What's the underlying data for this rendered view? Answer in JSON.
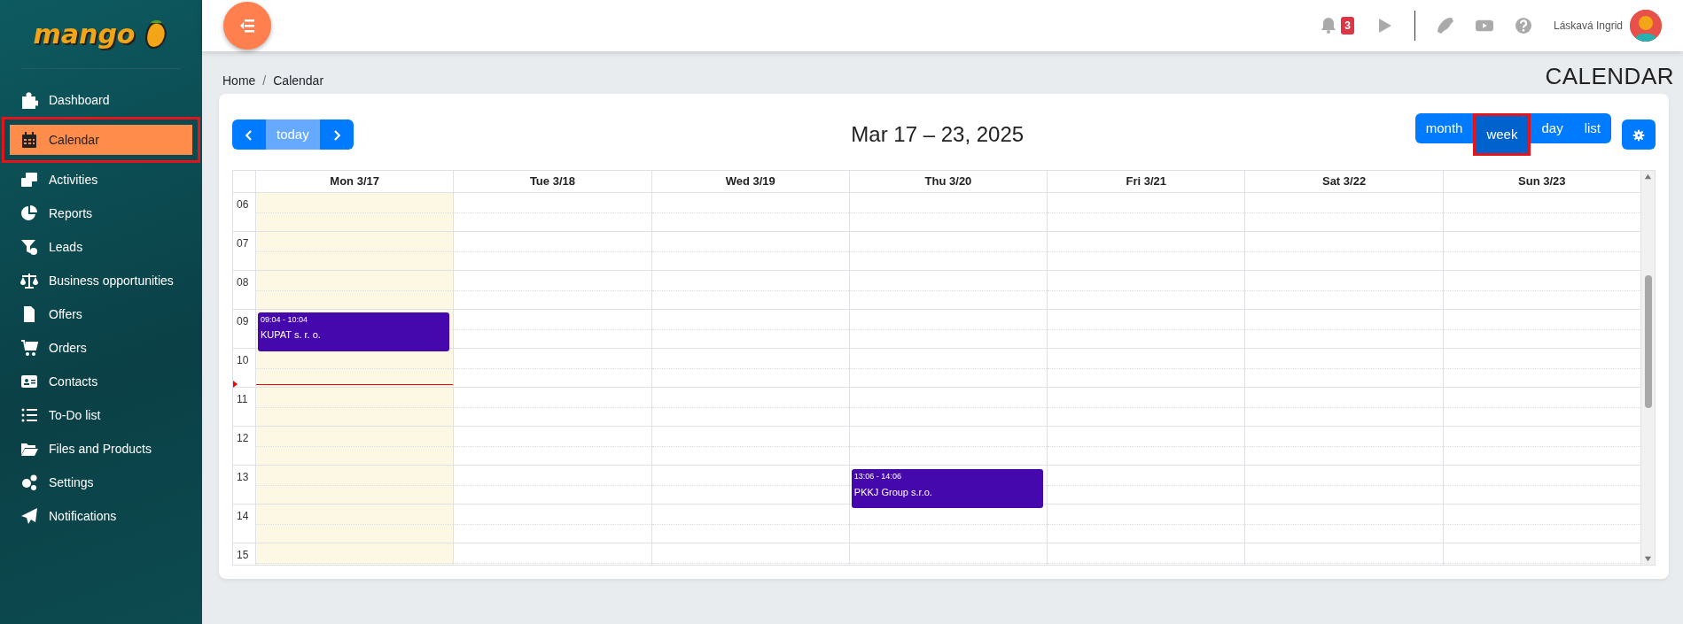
{
  "sidebar": {
    "logo": "mango",
    "items": [
      {
        "label": "Dashboard",
        "selected": false,
        "highlighted": false
      },
      {
        "label": "Calendar",
        "selected": true,
        "highlighted": true
      },
      {
        "label": "Activities",
        "selected": false,
        "highlighted": false
      },
      {
        "label": "Reports",
        "selected": false,
        "highlighted": false
      },
      {
        "label": "Leads",
        "selected": false,
        "highlighted": false
      },
      {
        "label": "Business opportunities",
        "selected": false,
        "highlighted": false
      },
      {
        "label": "Offers",
        "selected": false,
        "highlighted": false
      },
      {
        "label": "Orders",
        "selected": false,
        "highlighted": false
      },
      {
        "label": "Contacts",
        "selected": false,
        "highlighted": false
      },
      {
        "label": "To-Do list",
        "selected": false,
        "highlighted": false
      },
      {
        "label": "Files and Products",
        "selected": false,
        "highlighted": false
      },
      {
        "label": "Settings",
        "selected": false,
        "highlighted": false
      },
      {
        "label": "Notifications",
        "selected": false,
        "highlighted": false
      }
    ]
  },
  "header": {
    "notification_count": "3",
    "user_name": "Láskavá Ingrid"
  },
  "breadcrumb": {
    "items": [
      "Home",
      "Calendar"
    ],
    "separator": "/"
  },
  "page_title": "CALENDAR",
  "calendar": {
    "title": "Mar 17 – 23, 2025",
    "today_button": {
      "label": "today",
      "disabled": true
    },
    "views": [
      {
        "label": "month",
        "selected": false,
        "highlighted": false
      },
      {
        "label": "week",
        "selected": true,
        "highlighted": true
      },
      {
        "label": "day",
        "selected": false,
        "highlighted": false
      },
      {
        "label": "list",
        "selected": false,
        "highlighted": false
      }
    ],
    "hours": [
      "06",
      "07",
      "08",
      "09",
      "10",
      "11",
      "12",
      "13",
      "14",
      "15"
    ],
    "days": [
      {
        "label": "Mon 3/17",
        "today": true,
        "events": [
          {
            "time": "09:04 - 10:04",
            "title": "KUPAT s. r. o."
          }
        ]
      },
      {
        "label": "Tue 3/18",
        "today": false
      },
      {
        "label": "Wed 3/19",
        "today": false
      },
      {
        "label": "Thu 3/20",
        "today": false,
        "events": [
          {
            "time": "13:06 - 14:06",
            "title": "PKKJ Group s.r.o."
          }
        ]
      },
      {
        "label": "Fri 3/21",
        "today": false
      },
      {
        "label": "Sat 3/22",
        "today": false
      },
      {
        "label": "Sun 3/23",
        "today": false
      }
    ]
  }
}
